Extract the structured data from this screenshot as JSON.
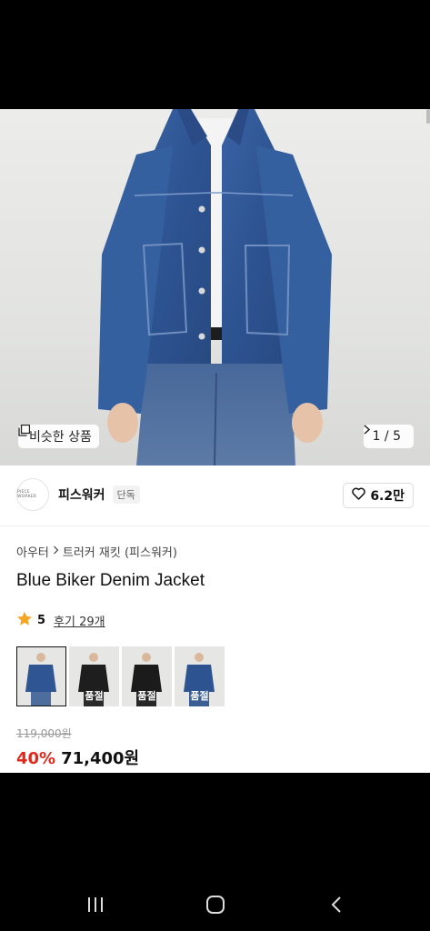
{
  "hero": {
    "similar_label": "비슷한 상품",
    "similar_icon": "copy-icon",
    "counter": "1 / 5",
    "next_icon": "chevron-right-icon"
  },
  "brand": {
    "logo_text": "PIECE WORKER",
    "name": "피스워커",
    "badge": "단독",
    "like_icon": "heart-outline-icon",
    "like_count": "6.2만"
  },
  "breadcrumb": {
    "category": "아우터",
    "separator_icon": "chevron-right-icon",
    "subcategory": "트러커 재킷 (피스워커)"
  },
  "product": {
    "title": "Blue Biker Denim Jacket",
    "rating": "5",
    "rating_icon": "star-icon",
    "review_link": "후기 29개",
    "star_color": "#f5a623"
  },
  "colors": {
    "discount": "#e0281c",
    "denim": "#2f5593"
  },
  "options": [
    {
      "variant": "blue",
      "selected": true,
      "label": ""
    },
    {
      "variant": "black",
      "selected": false,
      "label": "품절"
    },
    {
      "variant": "black",
      "selected": false,
      "label": "품절"
    },
    {
      "variant": "blue",
      "selected": false,
      "label": "품절"
    }
  ],
  "pricing": {
    "original": "119,000원",
    "discount": "40%",
    "sale": "71,400원"
  },
  "navigation": {
    "recent_icon": "recent-apps-icon",
    "home_icon": "home-icon",
    "back_icon": "back-icon"
  }
}
